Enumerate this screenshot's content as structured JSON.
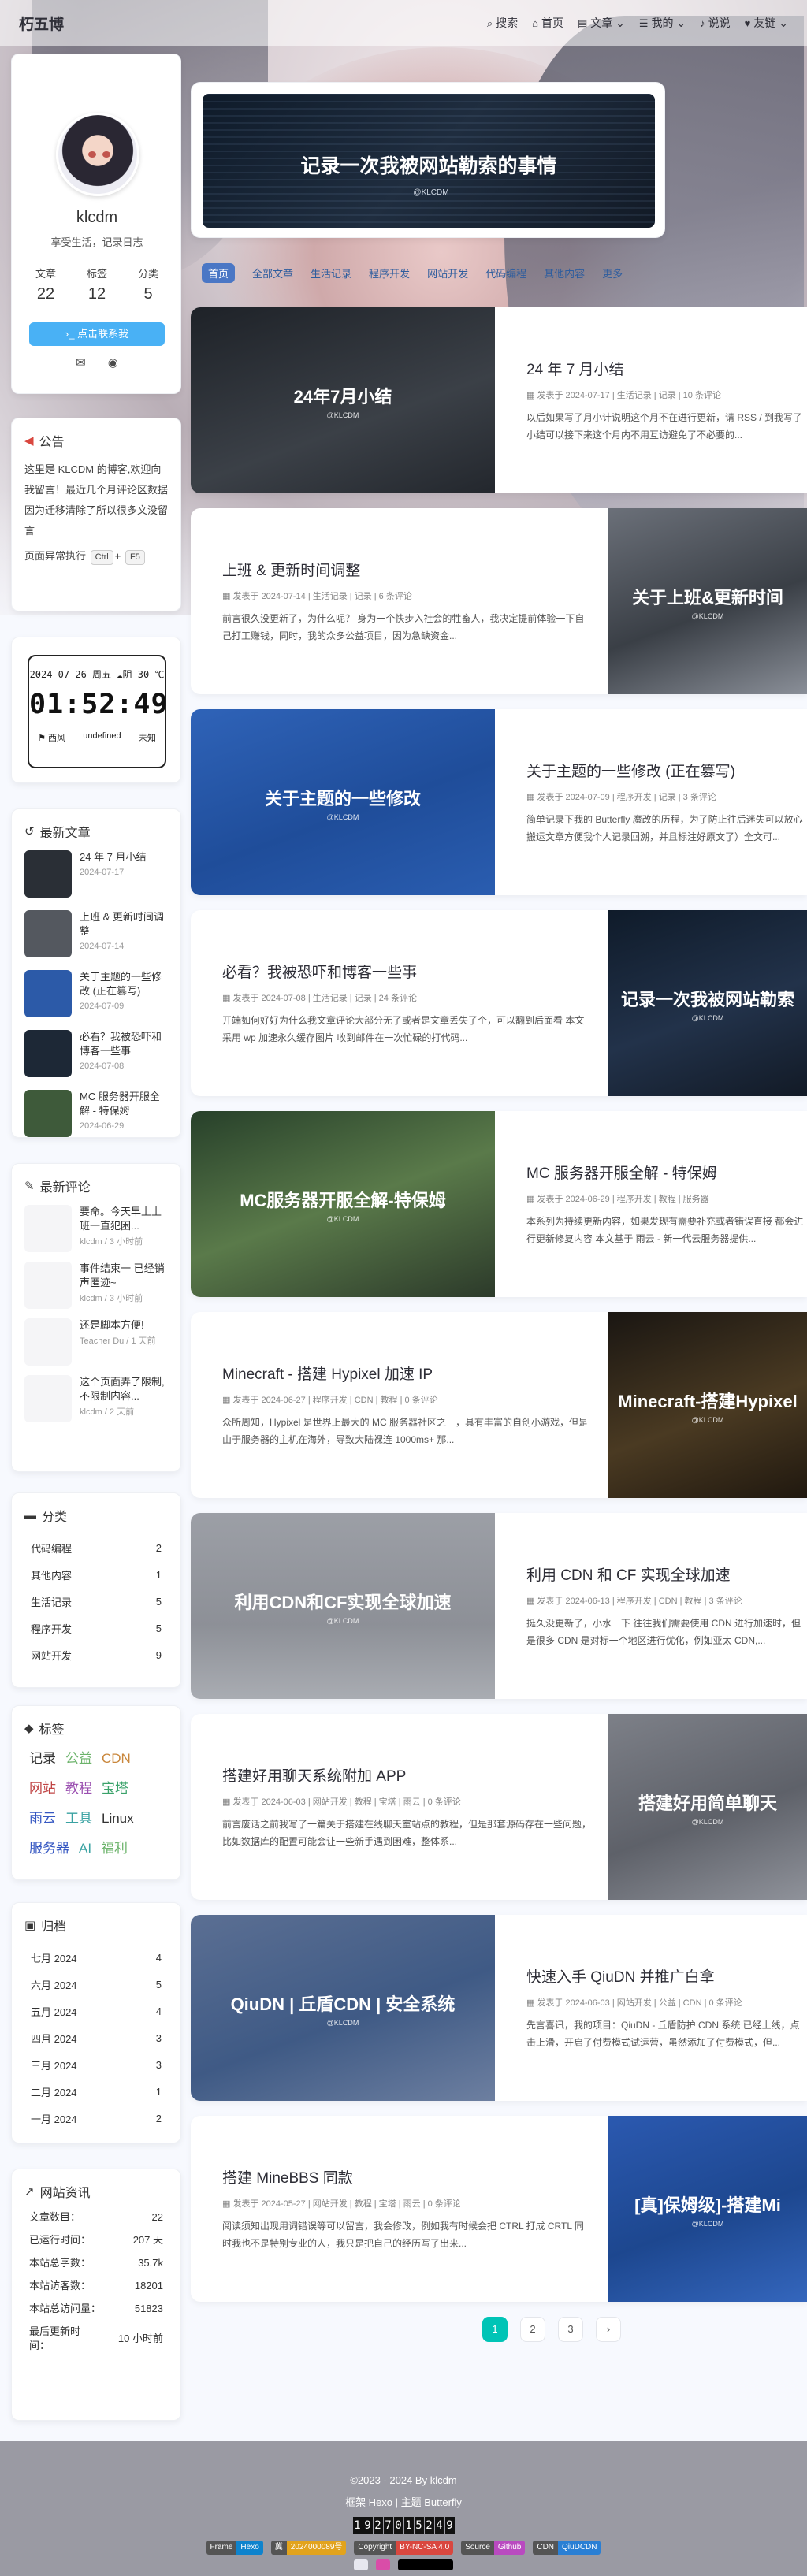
{
  "nav": {
    "brand": "朽五博",
    "items": [
      {
        "icon": "search-icon",
        "label": "搜索"
      },
      {
        "icon": "home-icon",
        "label": "首页"
      },
      {
        "icon": "folder-icon",
        "label": "文章"
      },
      {
        "icon": "list-icon",
        "label": "我的"
      },
      {
        "icon": "bell-icon",
        "label": "说说"
      },
      {
        "icon": "link-icon",
        "label": "友链"
      }
    ]
  },
  "profile": {
    "name": "klcdm",
    "desc": "享受生活，记录日志",
    "stats": [
      {
        "label": "文章",
        "value": "22"
      },
      {
        "label": "标签",
        "value": "12"
      },
      {
        "label": "分类",
        "value": "5"
      }
    ],
    "follow_label": "点击联系我",
    "follow_icon": "terminal-icon"
  },
  "announce": {
    "title": "公告",
    "text": "这里是 KLCDM 的博客,欢迎向我留言！最近几个月评论区数据因为迁移清除了所以很多文没留言",
    "tip_prefix": "页面异常执行",
    "key1": "Ctrl",
    "plus": "+",
    "key2": "F5"
  },
  "clock": {
    "date": "2024-07-26 周五",
    "weather": "阴 30 ℃",
    "time": "01:52:49",
    "city": "西风",
    "aqi": "undefined",
    "level": "未知"
  },
  "recent": {
    "title": "最新文章",
    "items": [
      {
        "title": "24 年 7 月小结",
        "date": "2024-07-17",
        "color": "#2a2f36"
      },
      {
        "title": "上班 & 更新时间调整",
        "date": "2024-07-14",
        "color": "#54585f"
      },
      {
        "title": "关于主题的一些修改 (正在篡写)",
        "date": "2024-07-09",
        "color": "#2c5aa8"
      },
      {
        "title": "必看？我被恐吓和博客一些事",
        "date": "2024-07-08",
        "color": "#1d2836"
      },
      {
        "title": "MC 服务器开服全解 - 特保姆",
        "date": "2024-06-29",
        "color": "#3e5a3a"
      }
    ]
  },
  "comments": {
    "title": "最新评论",
    "items": [
      {
        "text": "要命。今天早上上班一直犯困...",
        "meta": "klcdm / 3 小时前"
      },
      {
        "text": "事件结束一 已经销声匿迹~",
        "meta": "klcdm / 3 小时前"
      },
      {
        "text": "还是脚本方便!",
        "meta": "Teacher Du / 1 天前"
      },
      {
        "text": "这个页面弄了限制,不限制内容...",
        "meta": "klcdm / 2 天前"
      }
    ]
  },
  "categories": {
    "title": "分类",
    "items": [
      {
        "name": "代码编程",
        "count": "2"
      },
      {
        "name": "其他内容",
        "count": "1"
      },
      {
        "name": "生活记录",
        "count": "5"
      },
      {
        "name": "程序开发",
        "count": "5"
      },
      {
        "name": "网站开发",
        "count": "9"
      }
    ]
  },
  "tags": {
    "title": "标签",
    "items": [
      {
        "name": "记录",
        "color": "#333333"
      },
      {
        "name": "公益",
        "color": "#6bb36a"
      },
      {
        "name": "CDN",
        "color": "#c9873c"
      },
      {
        "name": "网站",
        "color": "#c04545"
      },
      {
        "name": "教程",
        "color": "#9a4fb0"
      },
      {
        "name": "宝塔",
        "color": "#3aa26a"
      },
      {
        "name": "雨云",
        "color": "#3557c2"
      },
      {
        "name": "工具",
        "color": "#3aa2a2"
      },
      {
        "name": "Linux",
        "color": "#333333"
      },
      {
        "name": "服务器",
        "color": "#3557c2"
      },
      {
        "name": "AI",
        "color": "#3aa2a2"
      },
      {
        "name": "福利",
        "color": "#6bb36a"
      }
    ]
  },
  "archive": {
    "title": "归档",
    "items": [
      {
        "name": "七月 2024",
        "count": "4"
      },
      {
        "name": "六月 2024",
        "count": "5"
      },
      {
        "name": "五月 2024",
        "count": "4"
      },
      {
        "name": "四月 2024",
        "count": "3"
      },
      {
        "name": "三月 2024",
        "count": "3"
      },
      {
        "name": "二月 2024",
        "count": "1"
      },
      {
        "name": "一月 2024",
        "count": "2"
      }
    ]
  },
  "site_stats": {
    "title": "网站资讯",
    "items": [
      {
        "label": "文章数目：",
        "value": "22"
      },
      {
        "label": "已运行时间：",
        "value": "207 天"
      },
      {
        "label": "本站总字数：",
        "value": "35.7k"
      },
      {
        "label": "本站访客数：",
        "value": "18201"
      },
      {
        "label": "本站总访问量：",
        "value": "51823"
      },
      {
        "label": "最后更新时间：",
        "value": "10 小时前"
      }
    ]
  },
  "hero": {
    "title": "记录一次我被网站勒索的事情",
    "watermark": "@KLCDM"
  },
  "tabs": [
    "首页",
    "全部文章",
    "生活记录",
    "程序开发",
    "网站开发",
    "代码编程",
    "其他内容",
    "更多"
  ],
  "posts": [
    {
      "side": "left",
      "img_title": "24年7月小结",
      "title": "24 年 7 月小结",
      "meta": "发表于 2024-07-17 | 生活记录 | 记录 | 10 条评论",
      "excerpt": "以后如果写了月小计说明这个月不在进行更新，请 RSS / 到我写了小结可以接下来这个月内不用互访避免了不必要的...",
      "bg": "linear-gradient(160deg,#1e2228,#3b4047 60%,#23272d)"
    },
    {
      "side": "right",
      "img_title": "关于上班&更新时间",
      "title": "上班 & 更新时间调整",
      "meta": "发表于 2024-07-14 | 生活记录 | 记录 | 6 条评论",
      "excerpt": "前言很久没更新了，为什么呢？ 身为一个快步入社会的牲畜人，我决定提前体验一下自己打工赚钱，同时，我的众多公益项目，因为急缺资金...",
      "bg": "linear-gradient(160deg,#6b7079,#3a3f46 55%,#8a8f98)"
    },
    {
      "side": "left",
      "img_title": "关于主题的一些修改",
      "title": "关于主题的一些修改 (正在篡写)",
      "meta": "发表于 2024-07-09 | 程序开发 | 记录 | 3 条评论",
      "excerpt": "简单记录下我的 Butterfly 魔改的历程，为了防止往后迷失可以放心搬运文章方便我个人记录回溯，并且标注好原文了）全文可...",
      "bg": "linear-gradient(160deg,#2f63b8,#1f4d9a 55%,#2a5db0)"
    },
    {
      "side": "right",
      "img_title": "记录一次我被网站勒索",
      "title": "必看？我被恐吓和博客一些事",
      "meta": "发表于 2024-07-08 | 生活记录 | 记录 | 24 条评论",
      "excerpt": "开端如何好好为什么我文章评论大部分无了或者是文章丢失了个，可以翻到后面看 本文采用 wp 加速永久缓存图片 收到邮件在一次忙碌的打代码...",
      "bg": "linear-gradient(160deg,#0f1b2a,#22324a 55%,#121a26)"
    },
    {
      "side": "left",
      "img_title": "MC服务器开服全解-特保姆",
      "title": "MC 服务器开服全解 - 特保姆",
      "meta": "发表于 2024-06-29 | 程序开发 | 教程 | 服务器",
      "excerpt": "本系列为持续更新内容，如果发现有需要补充或者错误直接 都会进行更新修复内容 本文基于 雨云 - 新一代云服务器提供...",
      "bg": "linear-gradient(160deg,#27402a,#5a7a4a 50%,#2c3a2a)"
    },
    {
      "side": "right",
      "img_title": "Minecraft-搭建Hypixel",
      "title": "Minecraft - 搭建 Hypixel 加速 IP",
      "meta": "发表于 2024-06-27 | 程序开发 | CDN | 教程 | 0 条评论",
      "excerpt": "众所周知，Hypixel 是世界上最大的 MC 服务器社区之一，具有丰富的自创小游戏，但是由于服务器的主机在海外，导致大陆裸连 1000ms+ 那...",
      "bg": "linear-gradient(160deg,#1a1612,#4a3a22 55%,#20180f)"
    },
    {
      "side": "left",
      "img_title": "利用CDN和CF实现全球加速",
      "title": "利用 CDN 和 CF 实现全球加速",
      "meta": "发表于 2024-06-13 | 程序开发 | CDN | 教程 | 3 条评论",
      "excerpt": "挺久没更新了，小水一下 往往我们需要使用 CDN 进行加速时，但是很多 CDN 是对标一个地区进行优化，例如亚太 CDN,...",
      "bg": "linear-gradient(180deg,#9c9fa6,#8d9097 60%,#a9acb2)"
    },
    {
      "side": "right",
      "img_title": "搭建好用简单聊天",
      "title": "搭建好用聊天系统附加 APP",
      "meta": "发表于 2024-06-03 | 网站开发 | 教程 | 宝塔 | 雨云 | 0 条评论",
      "excerpt": "前言废话之前我写了一篇关于搭建在线聊天室站点的教程，但是那套源码存在一些问题，比如数据库的配置可能会让一些新手遇到困难，整体系...",
      "bg": "linear-gradient(160deg,#7d8088,#5e6169 55%,#8f929a)"
    },
    {
      "side": "left",
      "img_title": "QiuDN | 丘盾CDN | 安全系统",
      "title": "快速入手 QiuDN 并推广白拿",
      "meta": "发表于 2024-06-03 | 网站开发 | 公益 | CDN | 0 条评论",
      "excerpt": "先言喜讯，我的项目：QiuDN - 丘盾防护 CDN 系统 已经上线，点击上滑，开启了付费模式试运营，虽然添加了付费模式，但...",
      "bg": "linear-gradient(160deg,#5b6f93,#3f5a85 55%,#6d7fa0)"
    },
    {
      "side": "right",
      "img_title": "[真]保姆级]-搭建Mi",
      "title": "搭建 MineBBS 同款",
      "meta": "发表于 2024-05-27 | 网站开发 | 教程 | 宝塔 | 雨云 | 0 条评论",
      "excerpt": "阅读须知出现用词错误等可以留言，我会修改，例如我有时候会把 CTRL 打成 CRTL 同时我也不是特别专业的人，我只是把自己的经历写了出来...",
      "bg": "linear-gradient(160deg,#2b59b0,#1d478f 55%,#3466bd)"
    }
  ],
  "pager": [
    "1",
    "2",
    "3",
    "›"
  ],
  "footer": {
    "copyright": "©2023 - 2024 By klcdm",
    "theme": "框架 Hexo | 主题 Butterfly",
    "runtime": [
      "1",
      "9",
      "2",
      "7",
      "0",
      "1",
      "5",
      "2",
      "4",
      "9"
    ],
    "badges": [
      {
        "l": "Frame",
        "r": "Hexo",
        "color": "#0e83cd"
      },
      {
        "l": "冀",
        "r": "2024000089号",
        "color": "#e2a31d"
      },
      {
        "l": "Copyright",
        "r": "BY-NC-SA 4.0",
        "color": "#d9473f"
      },
      {
        "l": "Source",
        "r": "Github",
        "color": "#b94ac0"
      },
      {
        "l": "CDN",
        "r": "QiuDCDN",
        "color": "#2a7fd4"
      }
    ]
  }
}
